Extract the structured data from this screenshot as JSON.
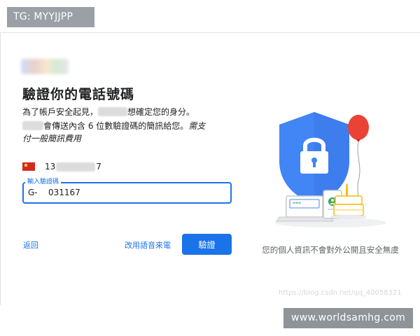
{
  "tg_badge": "TG: MYYJJPP",
  "title": "驗證你的電話號碼",
  "description": {
    "line1_prefix": "為了帳戶安全起見，",
    "line1_suffix": "想確定您的身分。",
    "line2_suffix": "會傳送內含 6 位數驗證碼的簡訊給您。",
    "line2_italic": "需支",
    "line3_italic": "付一般簡訊費用"
  },
  "phone": {
    "flag": "china-flag",
    "prefix": "13",
    "suffix": "7"
  },
  "code_field": {
    "label": "輸入驗證碼",
    "prefix": "G-",
    "value": "031167"
  },
  "actions": {
    "back": "返回",
    "voice_call": "改用語音來電",
    "verify": "驗證"
  },
  "privacy_text": "您的個人資訊不會對外公開且安全無虞",
  "watermark": "https://blog.csdn.net/qq_40058321",
  "site_badge": "www.worldsamhg.com",
  "colors": {
    "accent": "#1a73e8",
    "shield": "#4285f4",
    "balloon": "#ea4335"
  }
}
